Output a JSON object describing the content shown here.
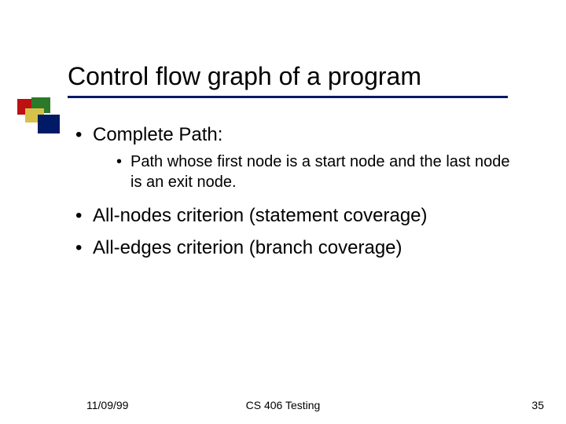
{
  "title": "Control flow graph of a program",
  "bullets": {
    "b0": "Complete Path:",
    "b0_sub0": "Path whose first node is a start node and the last node is an exit node.",
    "b1": "All-nodes criterion (statement coverage)",
    "b2": "All-edges criterion (branch coverage)"
  },
  "footer": {
    "left": "11/09/99",
    "center": "CS 406 Testing",
    "right": "35"
  }
}
